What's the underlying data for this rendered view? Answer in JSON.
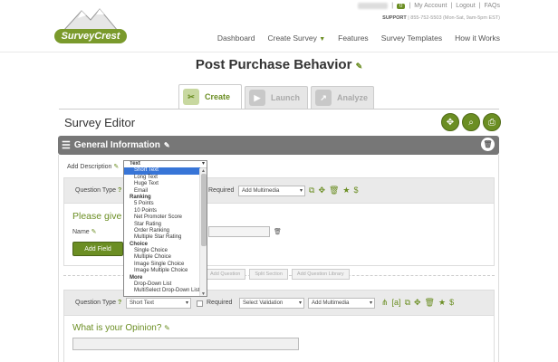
{
  "header": {
    "logo_text": "SurveyCrest",
    "user_name_blurred": "Account",
    "notification_count": "0",
    "links": [
      "My Account",
      "Logout",
      "FAQs"
    ],
    "support_label": "SUPPORT",
    "support_text": "| 855-752-5503 (Mon-Sat, 9am-5pm EST)",
    "nav": [
      "Dashboard",
      "Create Survey",
      "Features",
      "Survey Templates",
      "How it Works"
    ]
  },
  "page_title": "Post Purchase Behavior",
  "tabs": [
    {
      "label": "Create",
      "icon": "tools-icon",
      "active": true
    },
    {
      "label": "Launch",
      "icon": "play-icon",
      "active": false
    },
    {
      "label": "Analyze",
      "icon": "chart-icon",
      "active": false
    }
  ],
  "editor": {
    "title": "Survey Editor",
    "buttons": [
      "move-icon",
      "preview-icon",
      "print-icon"
    ]
  },
  "section": {
    "title": "General Information",
    "add_description": "Add Description"
  },
  "question1": {
    "type_label": "Question Type",
    "required_label": "Required",
    "multimedia": "Add Multimedia",
    "text": "Please give y",
    "field_label": "Name",
    "add_field": "Add Field"
  },
  "between_buttons": [
    "Add Question",
    "Split Section",
    "Add Question Library"
  ],
  "question2": {
    "type_label": "Question Type",
    "type_value": "Short Text",
    "required_label": "Required",
    "validation": "Select Validation",
    "multimedia": "Add Multimedia",
    "text": "What is your Opinion?"
  },
  "dropdown": [
    {
      "group": "Text",
      "options": [
        "Short Text",
        "Long Text",
        "Huge Text",
        "Email"
      ]
    },
    {
      "group": "Ranking",
      "options": [
        "5 Points",
        "10 Points",
        "Net Promoter Score",
        "Star Rating",
        "Order Ranking",
        "Multiple Star Rating"
      ]
    },
    {
      "group": "Choice",
      "options": [
        "Single Choice",
        "Multiple Choice",
        "Image Single Choice",
        "Image Multiple Choice"
      ]
    },
    {
      "group": "More",
      "options": [
        "Drop-Down List",
        "MultiSelect Drop-Down List"
      ]
    }
  ],
  "dropdown_highlighted": "Short Text",
  "colors": {
    "brand": "#6b8e23",
    "section_bar": "#777777",
    "highlight": "#3875d7"
  }
}
